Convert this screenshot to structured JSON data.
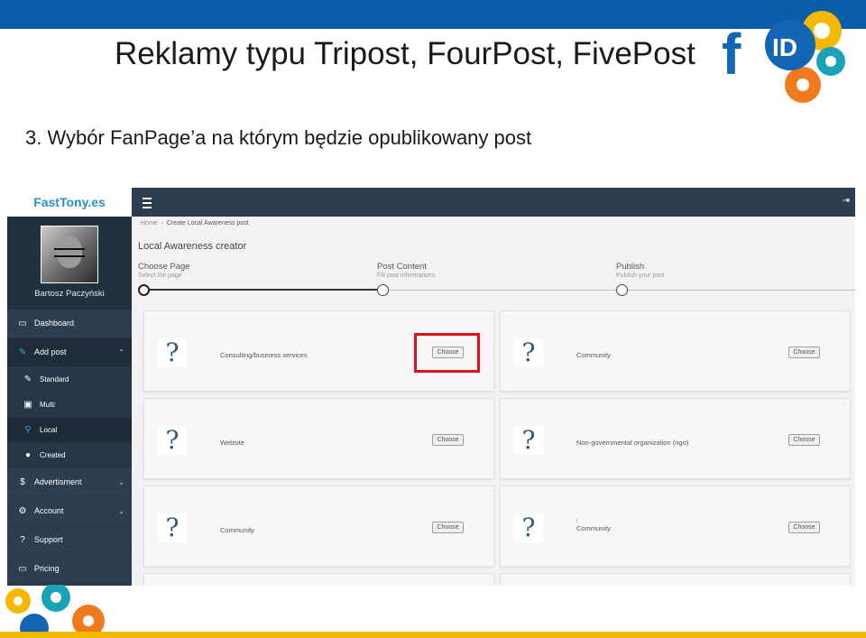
{
  "slide": {
    "title": "Reklamy typu Tripost, FourPost, FivePost",
    "subtitle": "3. Wybór FanPage’a na którym będzie opublikowany post",
    "logo_text": "fID",
    "colors": {
      "topbar": "#0a5ea8",
      "bottom_strip": "#f5b800",
      "highlight": "#d9151b"
    }
  },
  "app": {
    "brand": "FastTony.es",
    "user_name": "Bartosz Paczyński",
    "nav": [
      {
        "label": "Dashboard",
        "icon": "monitor-icon"
      },
      {
        "label": "Add post",
        "icon": "edit-icon",
        "open": true
      },
      {
        "label": "Standard",
        "icon": "edit-icon",
        "sub": true
      },
      {
        "label": "Multi",
        "icon": "image-icon",
        "sub": true
      },
      {
        "label": "Local",
        "icon": "map-pin-icon",
        "sub": true,
        "active": true
      },
      {
        "label": "Created",
        "icon": "user-icon",
        "sub": true
      },
      {
        "label": "Advertisment",
        "icon": "dollar-icon",
        "chevron": true
      },
      {
        "label": "Account",
        "icon": "cogs-icon",
        "chevron": true
      },
      {
        "label": "Support",
        "icon": "question-circle-icon"
      },
      {
        "label": "Pricing",
        "icon": "money-icon"
      }
    ],
    "breadcrumb": {
      "home": "Home",
      "separator": "›",
      "current": "Create Local Awareness post"
    },
    "page_title": "Local Awareness creator",
    "steps": [
      {
        "title": "Choose Page",
        "desc": "Select the page",
        "active": true
      },
      {
        "title": "Post Content",
        "desc": "Fill post informations"
      },
      {
        "title": "Publish",
        "desc": "Publish your post"
      }
    ],
    "choose_label": "Choose",
    "pages": [
      {
        "category": "Consulting/business services",
        "highlighted": true
      },
      {
        "category": "Community"
      },
      {
        "category": "Website"
      },
      {
        "category": "Non-governmental organization (ngo)"
      },
      {
        "category": "Community"
      },
      {
        "category": "Community",
        "extra": "I"
      }
    ]
  }
}
